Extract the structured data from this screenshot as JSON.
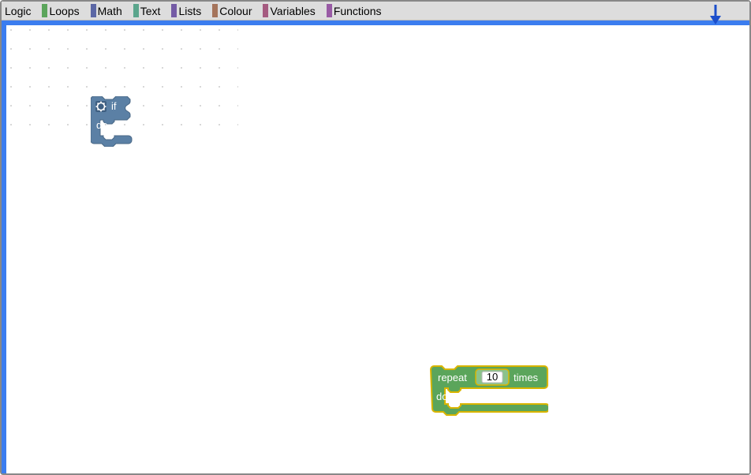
{
  "toolbox": {
    "items": [
      {
        "label": "Logic",
        "color": "#5b80a5"
      },
      {
        "label": "Loops",
        "color": "#5ba55b"
      },
      {
        "label": "Math",
        "color": "#5b67a5"
      },
      {
        "label": "Text",
        "color": "#5ba58c"
      },
      {
        "label": "Lists",
        "color": "#745ba5"
      },
      {
        "label": "Colour",
        "color": "#a5745b"
      },
      {
        "label": "Variables",
        "color": "#a55b80"
      },
      {
        "label": "Functions",
        "color": "#995ba5"
      }
    ]
  },
  "blocks": {
    "if": {
      "ifLabel": "if",
      "doLabel": "do",
      "gearIcon": "gear-icon"
    },
    "repeat": {
      "repeatLabel": "repeat",
      "countValue": "10",
      "timesLabel": "times",
      "doLabel": "do"
    }
  }
}
